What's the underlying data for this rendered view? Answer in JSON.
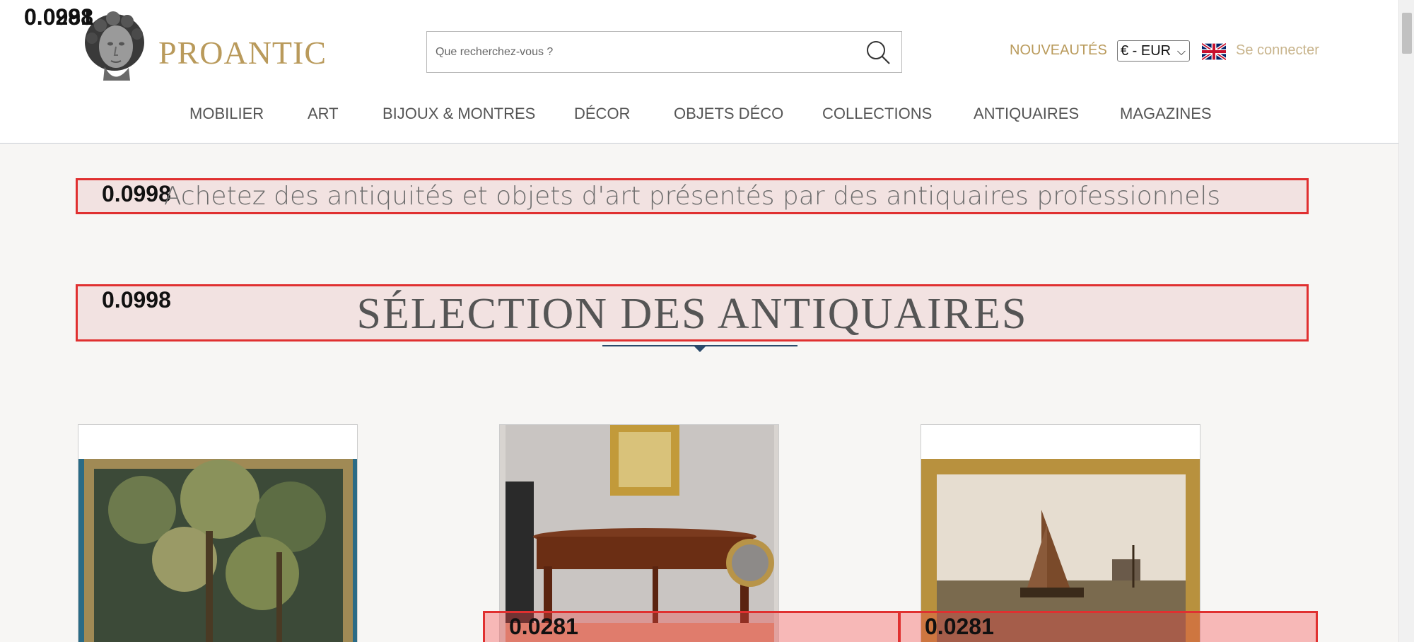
{
  "header": {
    "logo_text": "PROANTIC",
    "search_placeholder": "Que recherchez-vous ?",
    "nouveautes": "NOUVEAUTÉS",
    "currency": "€ - EUR",
    "login": "Se connecter"
  },
  "nav": {
    "items": [
      "MOBILIER",
      "ART",
      "BIJOUX & MONTRES",
      "DÉCOR",
      "OBJETS DÉCO",
      "COLLECTIONS",
      "ANTIQUAIRES",
      "MAGAZINES"
    ]
  },
  "main": {
    "tagline": "Achetez des antiquités et objets d'art présentés par des antiquaires professionnels",
    "section_title": "SÉLECTION DES ANTIQUAIRES"
  },
  "overlays": {
    "corner_score_a": "0.0281",
    "corner_score_b": "0.0998",
    "tagline_score": "0.0998",
    "title_score": "0.0998",
    "card_score_1": "0.0281",
    "card_score_2": "0.0281"
  },
  "colors": {
    "brand_gold": "#b99a5b",
    "accent_navy": "#2b4a6a",
    "overlay_red": "#e03030"
  }
}
